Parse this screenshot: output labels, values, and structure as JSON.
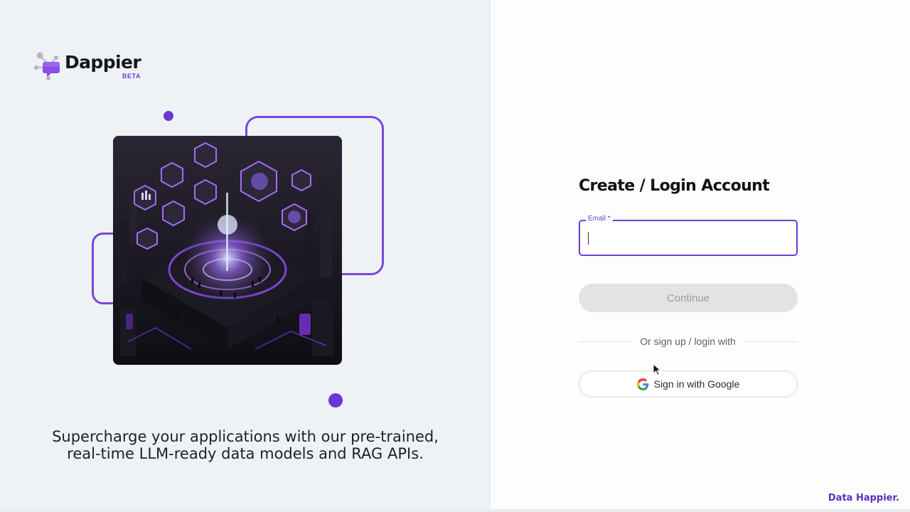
{
  "brand": {
    "name": "Dappier",
    "badge": "BETA",
    "accent_color": "#6e3bd8",
    "logo_icon": "network-node-chat-icon"
  },
  "left_panel": {
    "tagline_line1": "Supercharge your applications with our pre-trained,",
    "tagline_line2": "real-time LLM-ready data models and RAG APIs.",
    "illustration": "ai-data-city-illustration"
  },
  "form": {
    "title": "Create / Login Account",
    "email": {
      "label": "Email *",
      "value": "",
      "placeholder": ""
    },
    "continue_label": "Continue",
    "divider_text": "Or sign up / login with",
    "google_label": "Sign in with Google",
    "google_icon": "google-g-icon"
  },
  "footer": {
    "tagline": "Data Happier."
  }
}
